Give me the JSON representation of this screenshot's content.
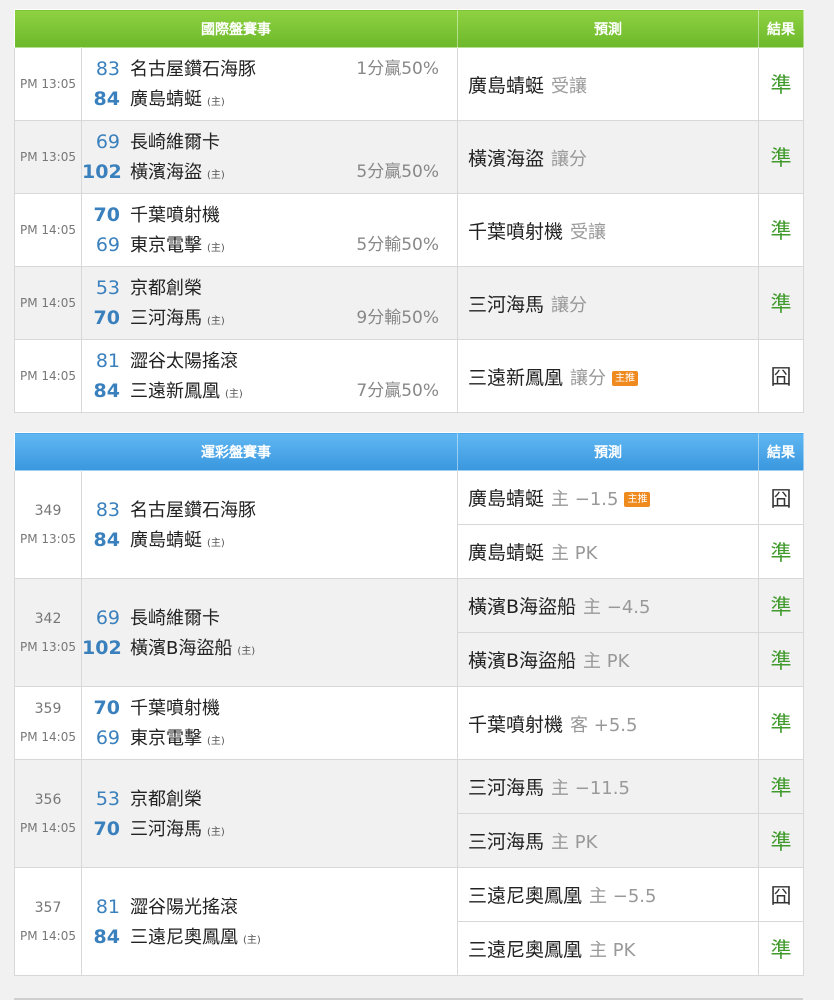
{
  "intl": {
    "headers": [
      "國際盤賽事",
      "預測",
      "結果"
    ],
    "rows": [
      {
        "time": "PM 13:05",
        "home_mark": "(主)",
        "a": {
          "num": "83",
          "name": "名古屋鑽石海豚",
          "line": "1分贏50%"
        },
        "b": {
          "num": "84",
          "name": "廣島蜻蜓",
          "line": ""
        },
        "pred_team": "廣島蜻蜓",
        "pred_type": "受讓",
        "badge": "",
        "result": "準"
      },
      {
        "time": "PM 13:05",
        "home_mark": "(主)",
        "a": {
          "num": "69",
          "name": "長崎維爾卡",
          "line": ""
        },
        "b": {
          "num": "102",
          "name": "橫濱海盜",
          "line": "5分贏50%"
        },
        "pred_team": "橫濱海盜",
        "pred_type": "讓分",
        "badge": "",
        "result": "準"
      },
      {
        "time": "PM 14:05",
        "home_mark": "(主)",
        "a": {
          "num": "70",
          "name": "千葉噴射機",
          "line": ""
        },
        "b": {
          "num": "69",
          "name": "東京電擊",
          "line": "5分輸50%"
        },
        "pred_team": "千葉噴射機",
        "pred_type": "受讓",
        "badge": "",
        "result": "準"
      },
      {
        "time": "PM 14:05",
        "home_mark": "(主)",
        "a": {
          "num": "53",
          "name": "京都創榮",
          "line": ""
        },
        "b": {
          "num": "70",
          "name": "三河海馬",
          "line": "9分輸50%"
        },
        "pred_team": "三河海馬",
        "pred_type": "讓分",
        "badge": "",
        "result": "準"
      },
      {
        "time": "PM 14:05",
        "home_mark": "(主)",
        "a": {
          "num": "81",
          "name": "澀谷太陽搖滾",
          "line": ""
        },
        "b": {
          "num": "84",
          "name": "三遠新鳳凰",
          "line": "7分贏50%"
        },
        "pred_team": "三遠新鳳凰",
        "pred_type": "讓分",
        "badge": "主推",
        "result": "囧"
      }
    ]
  },
  "sports": {
    "headers": [
      "運彩盤賽事",
      "預測",
      "結果"
    ],
    "rows": [
      {
        "id": "349",
        "time": "PM 13:05",
        "home_mark": "(主)",
        "a": {
          "num": "83",
          "name": "名古屋鑽石海豚"
        },
        "b": {
          "num": "84",
          "name": "廣島蜻蜓"
        },
        "preds": [
          {
            "team": "廣島蜻蜓",
            "type": "主 −1.5",
            "badge": "主推",
            "result": "囧"
          },
          {
            "team": "廣島蜻蜓",
            "type": "主 PK",
            "badge": "",
            "result": "準"
          }
        ]
      },
      {
        "id": "342",
        "time": "PM 13:05",
        "home_mark": "(主)",
        "a": {
          "num": "69",
          "name": "長崎維爾卡"
        },
        "b": {
          "num": "102",
          "name": "橫濱B海盜船"
        },
        "preds": [
          {
            "team": "橫濱B海盜船",
            "type": "主 −4.5",
            "badge": "",
            "result": "準"
          },
          {
            "team": "橫濱B海盜船",
            "type": "主 PK",
            "badge": "",
            "result": "準"
          }
        ]
      },
      {
        "id": "359",
        "time": "PM 14:05",
        "home_mark": "(主)",
        "a": {
          "num": "70",
          "name": "千葉噴射機"
        },
        "b": {
          "num": "69",
          "name": "東京電擊"
        },
        "preds": [
          {
            "team": "千葉噴射機",
            "type": "客 +5.5",
            "badge": "",
            "result": "準"
          }
        ]
      },
      {
        "id": "356",
        "time": "PM 14:05",
        "home_mark": "(主)",
        "a": {
          "num": "53",
          "name": "京都創榮"
        },
        "b": {
          "num": "70",
          "name": "三河海馬"
        },
        "preds": [
          {
            "team": "三河海馬",
            "type": "主 −11.5",
            "badge": "",
            "result": "準"
          },
          {
            "team": "三河海馬",
            "type": "主 PK",
            "badge": "",
            "result": "準"
          }
        ]
      },
      {
        "id": "357",
        "time": "PM 14:05",
        "home_mark": "(主)",
        "a": {
          "num": "81",
          "name": "澀谷陽光搖滾"
        },
        "b": {
          "num": "84",
          "name": "三遠尼奧鳳凰"
        },
        "preds": [
          {
            "team": "三遠尼奧鳳凰",
            "type": "主 −5.5",
            "badge": "",
            "result": "囧"
          },
          {
            "team": "三遠尼奧鳳凰",
            "type": "主 PK",
            "badge": "",
            "result": "準"
          }
        ]
      }
    ]
  },
  "colors": {
    "green_header": "#7cc436",
    "blue_header": "#4aa6e8",
    "hit": "#3f9a2b",
    "badge": "#ef8a1f",
    "team_num": "#3a80bd"
  }
}
